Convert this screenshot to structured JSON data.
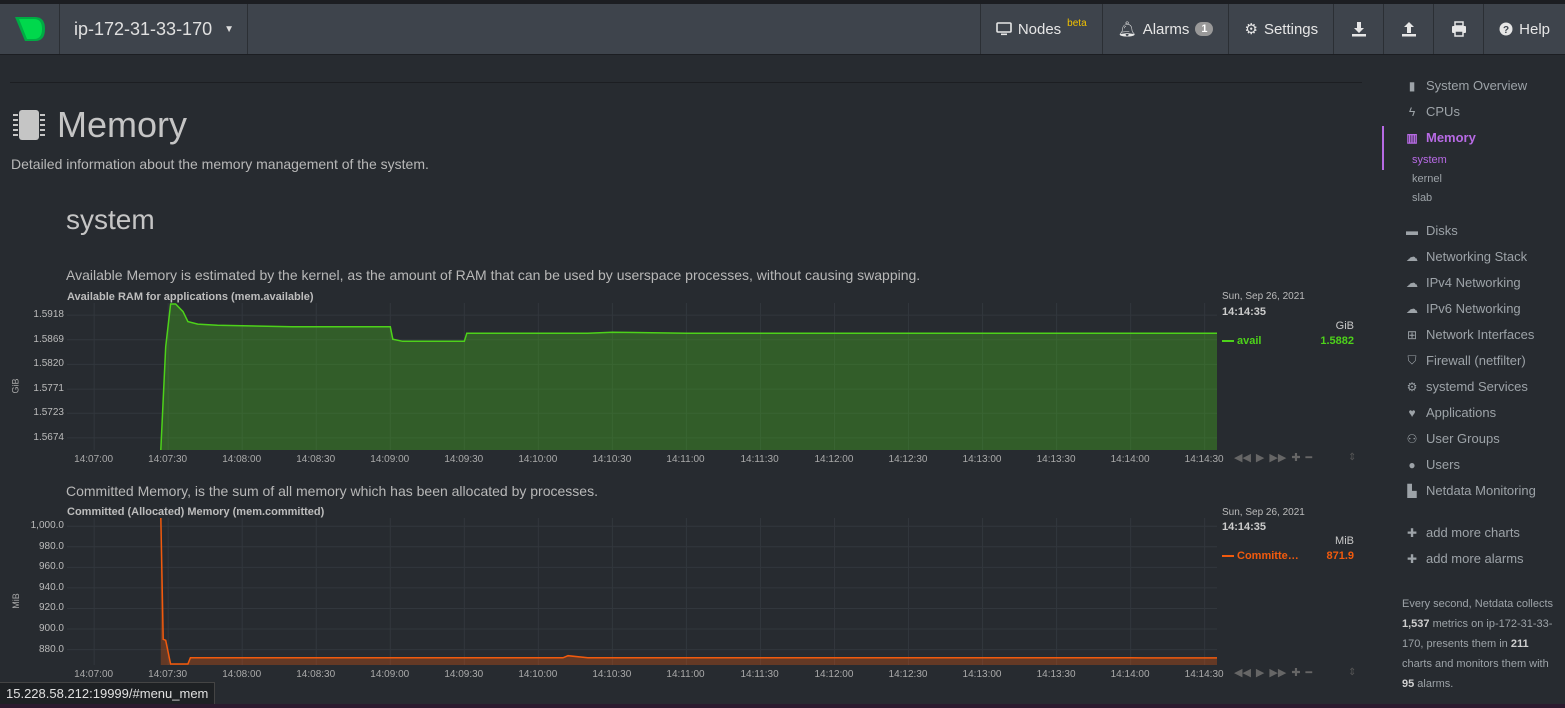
{
  "header": {
    "host": "ip-172-31-33-170",
    "nodes_label": "Nodes",
    "nodes_badge": "beta",
    "alarms_label": "Alarms",
    "alarms_count": "1",
    "settings_label": "Settings",
    "help_label": "Help"
  },
  "section": {
    "title": "Memory",
    "description": "Detailed information about the memory management of the system.",
    "subsection": "system"
  },
  "charts": [
    {
      "description": "Available Memory is estimated by the kernel, as the amount of RAM that can be used by userspace processes, without causing swapping.",
      "title": "Available RAM for applications (mem.available)",
      "ylabel": "GiB",
      "yticks": [
        "1.5918",
        "1.5869",
        "1.5820",
        "1.5771",
        "1.5723",
        "1.5674"
      ],
      "xticks": [
        "14:07:00",
        "14:07:30",
        "14:08:00",
        "14:08:30",
        "14:09:00",
        "14:09:30",
        "14:10:00",
        "14:10:30",
        "14:11:00",
        "14:11:30",
        "14:12:00",
        "14:12:30",
        "14:13:00",
        "14:13:30",
        "14:14:00",
        "14:14:30"
      ],
      "legend_date": "Sun, Sep 26, 2021",
      "legend_time": "14:14:35",
      "legend_unit": "GiB",
      "series_name": "avail",
      "series_value": "1.5882",
      "color": "#4dd21a"
    },
    {
      "description": "Committed Memory, is the sum of all memory which has been allocated by processes.",
      "title": "Committed (Allocated) Memory (mem.committed)",
      "ylabel": "MiB",
      "yticks": [
        "1,000.0",
        "980.0",
        "960.0",
        "940.0",
        "920.0",
        "900.0",
        "880.0"
      ],
      "xticks": [
        "14:07:00",
        "14:07:30",
        "14:08:00",
        "14:08:30",
        "14:09:00",
        "14:09:30",
        "14:10:00",
        "14:10:30",
        "14:11:00",
        "14:11:30",
        "14:12:00",
        "14:12:30",
        "14:13:00",
        "14:13:30",
        "14:14:00",
        "14:14:30"
      ],
      "legend_date": "Sun, Sep 26, 2021",
      "legend_time": "14:14:35",
      "legend_unit": "MiB",
      "series_name": "Committe…",
      "series_value": "871.9",
      "color": "#f25a0d"
    }
  ],
  "chart_data": [
    {
      "type": "area",
      "title": "Available RAM for applications (mem.available)",
      "ylabel": "GiB",
      "ylim": [
        1.565,
        1.5942
      ],
      "x": [
        "14:07:27",
        "14:07:29",
        "14:07:31",
        "14:07:33",
        "14:07:36",
        "14:07:38",
        "14:07:42",
        "14:07:50",
        "14:08:20",
        "14:09:00",
        "14:09:01",
        "14:09:05",
        "14:09:27",
        "14:09:30",
        "14:09:31",
        "14:10:20",
        "14:10:30",
        "14:11:00",
        "14:12:00",
        "14:13:00",
        "14:14:00",
        "14:14:35"
      ],
      "series": [
        {
          "name": "avail",
          "values": [
            1.565,
            1.5855,
            1.594,
            1.594,
            1.5925,
            1.5905,
            1.59,
            1.5898,
            1.5895,
            1.5895,
            1.587,
            1.5866,
            1.5866,
            1.5866,
            1.5882,
            1.5882,
            1.5884,
            1.5882,
            1.5882,
            1.5882,
            1.5882,
            1.5882
          ]
        }
      ]
    },
    {
      "type": "area",
      "title": "Committed (Allocated) Memory (mem.committed)",
      "ylabel": "MiB",
      "ylim": [
        865,
        1008
      ],
      "x": [
        "14:07:27",
        "14:07:28",
        "14:07:29",
        "14:07:31",
        "14:07:38",
        "14:07:39",
        "14:08:30",
        "14:09:30",
        "14:10:10",
        "14:10:12",
        "14:10:20",
        "14:11:00",
        "14:12:00",
        "14:13:00",
        "14:14:00",
        "14:14:35"
      ],
      "series": [
        {
          "name": "Committed",
          "values": [
            1010,
            890,
            889,
            866,
            866,
            872,
            872,
            872,
            872,
            874,
            872,
            872,
            872,
            872,
            872,
            871.9
          ]
        }
      ]
    }
  ],
  "sidebar": {
    "items": [
      {
        "label": "System Overview",
        "icon": "bookmark-icon"
      },
      {
        "label": "CPUs",
        "icon": "bolt-icon"
      },
      {
        "label": "Memory",
        "icon": "memory-icon"
      },
      {
        "label": "Disks",
        "icon": "hdd-icon"
      },
      {
        "label": "Networking Stack",
        "icon": "cloud-icon"
      },
      {
        "label": "IPv4 Networking",
        "icon": "cloud-icon"
      },
      {
        "label": "IPv6 Networking",
        "icon": "cloud-icon"
      },
      {
        "label": "Network Interfaces",
        "icon": "sitemap-icon"
      },
      {
        "label": "Firewall (netfilter)",
        "icon": "shield-icon"
      },
      {
        "label": "systemd Services",
        "icon": "cogs-icon"
      },
      {
        "label": "Applications",
        "icon": "heartbeat-icon"
      },
      {
        "label": "User Groups",
        "icon": "users-icon"
      },
      {
        "label": "Users",
        "icon": "user-icon"
      },
      {
        "label": "Netdata Monitoring",
        "icon": "bar-chart-icon"
      }
    ],
    "subitems": [
      "system",
      "kernel",
      "slab"
    ],
    "add_charts": "add more charts",
    "add_alarms": "add more alarms",
    "foot": {
      "t1": "Every second, Netdata collects ",
      "metrics": "1,537",
      "t2": " metrics on ip-172-31-33-170, presents them in ",
      "charts": "211",
      "t3": " charts and monitors them with ",
      "alarms": "95",
      "t4": " alarms."
    }
  },
  "status_url": "15.228.58.212:19999/#menu_mem"
}
